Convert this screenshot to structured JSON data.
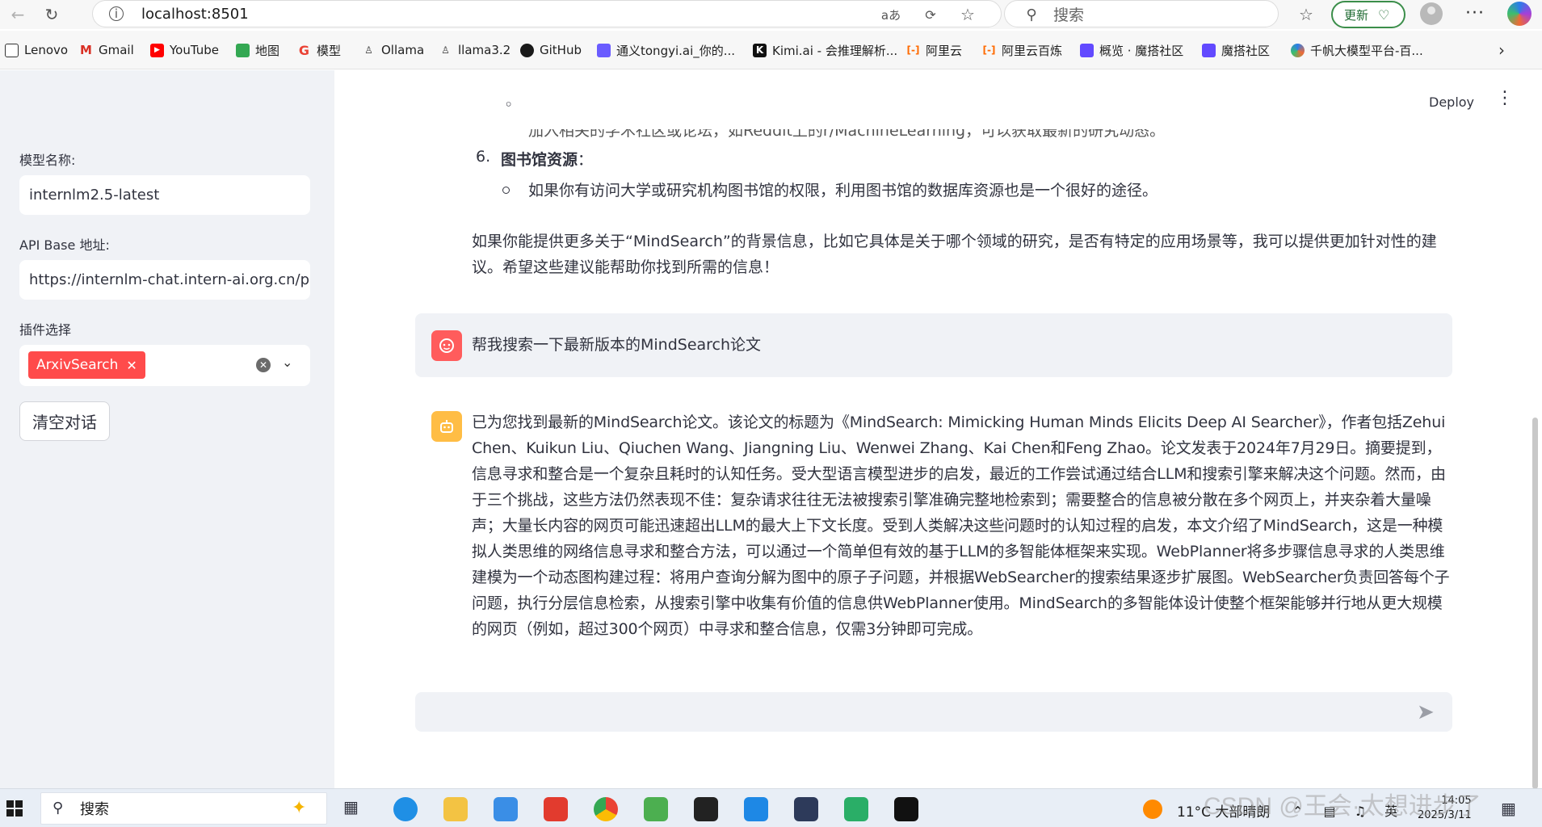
{
  "browser": {
    "url": "localhost:8501",
    "search_placeholder": "搜索",
    "update_label": "更新",
    "bookmarks": [
      "Lenovo",
      "Gmail",
      "YouTube",
      "地图",
      "模型",
      "Ollama",
      "llama3.2",
      "GitHub",
      "通义tongyi.ai_你的...",
      "Kimi.ai - 会推理解析...",
      "阿里云",
      "阿里云百炼",
      "概览 · 魔搭社区",
      "魔搭社区",
      "千帆大模型平台-百..."
    ]
  },
  "sidebar": {
    "model_label": "模型名称:",
    "model_value": "internlm2.5-latest",
    "api_label": "API Base 地址:",
    "api_value": "https://internlm-chat.intern-ai.org.cn/pu",
    "plugin_label": "插件选择",
    "plugin_chip": "ArxivSearch",
    "clear_button": "清空对话"
  },
  "main": {
    "deploy_label": "Deploy",
    "clipped_line": "加入相关的学术社区或论坛，如Reddit上的r/MachineLearning，可以获取最新的研究动态。",
    "item6_number": "6.",
    "item6_heading": "图书馆资源",
    "item6_colon": "：",
    "item6_sub": "如果你有访问大学或研究机构图书馆的权限，利用图书馆的数据库资源也是一个很好的途径。",
    "para1": "如果你能提供更多关于“MindSearch”的背景信息，比如它具体是关于哪个领域的研究，是否有特定的应用场景等，我可以提供更加针对性的建议。希望这些建议能帮助你找到所需的信息！",
    "user_message": "帮我搜索一下最新版本的MindSearch论文",
    "assistant_answer": "已为您找到最新的MindSearch论文。该论文的标题为《MindSearch: Mimicking Human Minds Elicits Deep AI Searcher》，作者包括Zehui Chen、Kuikun Liu、Qiuchen Wang、Jiangning Liu、Wenwei Zhang、Kai Chen和Feng Zhao。论文发表于2024年7月29日。摘要提到，信息寻求和整合是一个复杂且耗时的认知任务。受大型语言模型进步的启发，最近的工作尝试通过结合LLM和搜索引擎来解决这个问题。然而，由于三个挑战，这些方法仍然表现不佳：复杂请求往往无法被搜索引擎准确完整地检索到；需要整合的信息被分散在多个网页上，并夹杂着大量噪声；大量长内容的网页可能迅速超出LLM的最大上下文长度。受到人类解决这些问题时的认知过程的启发，本文介绍了MindSearch，这是一种模拟人类思维的网络信息寻求和整合方法，可以通过一个简单但有效的基于LLM的多智能体框架来实现。WebPlanner将多步骤信息寻求的人类思维建模为一个动态图构建过程：将用户查询分解为图中的原子子问题，并根据WebSearcher的搜索结果逐步扩展图。WebSearcher负责回答每个子问题，执行分层信息检索，从搜索引擎中收集有价值的信息供WebPlanner使用。MindSearch的多智能体设计使整个框架能够并行地从更大规模的网页（例如，超过300个网页）中寻求和整合信息，仅需3分钟即可完成。"
  },
  "taskbar": {
    "search_text": "搜索",
    "weather": "11°C  大部晴朗",
    "tray_text": "英",
    "time": "14:05",
    "date": "2025/3/11",
    "watermark": "CSDN @王会·太想进步了"
  },
  "colors": {
    "accent_red": "#ff4b4b",
    "sidebar_bg": "#f0f2f6",
    "user_avatar": "#ff5c5c",
    "bot_avatar": "#ffbd45"
  }
}
